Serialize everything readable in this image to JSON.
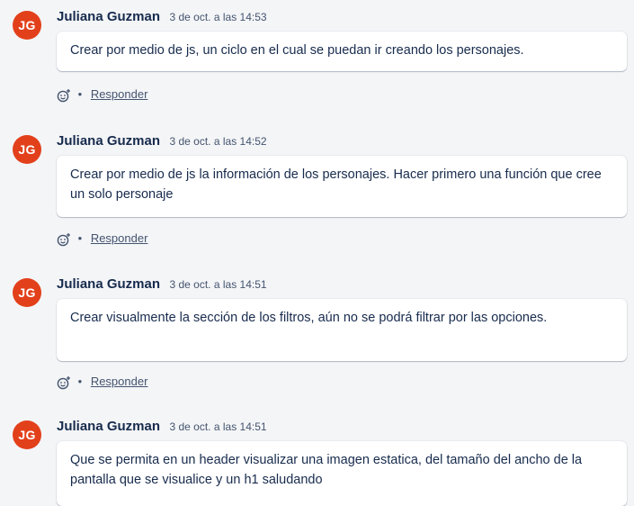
{
  "comments": [
    {
      "avatar_initials": "JG",
      "author": "Juliana Guzman",
      "timestamp": "3 de oct. a las 14:53",
      "text": "Crear por medio de js, un ciclo en el cual se puedan ir creando los personajes.",
      "reply_label": "Responder"
    },
    {
      "avatar_initials": "JG",
      "author": "Juliana Guzman",
      "timestamp": "3 de oct. a las 14:52",
      "text": "Crear por medio de js la información de los personajes. Hacer primero una función que cree un solo personaje",
      "reply_label": "Responder"
    },
    {
      "avatar_initials": "JG",
      "author": "Juliana Guzman",
      "timestamp": "3 de oct. a las 14:51",
      "text": "Crear visualmente la sección de los filtros, aún no se podrá filtrar por las opciones.",
      "reply_label": "Responder"
    },
    {
      "avatar_initials": "JG",
      "author": "Juliana Guzman",
      "timestamp": "3 de oct. a las 14:51",
      "text": "Que se permita en un header visualizar una imagen estatica, del tamaño del ancho de la pantalla que se visualice y un h1 saludando"
    }
  ],
  "separator": "•",
  "colors": {
    "avatar_bg": "#e2401b",
    "page_bg": "#f4f5f7",
    "text": "#172b4d",
    "subtle_text": "#44546f"
  },
  "icons": {
    "reaction": "add-reaction-icon"
  }
}
